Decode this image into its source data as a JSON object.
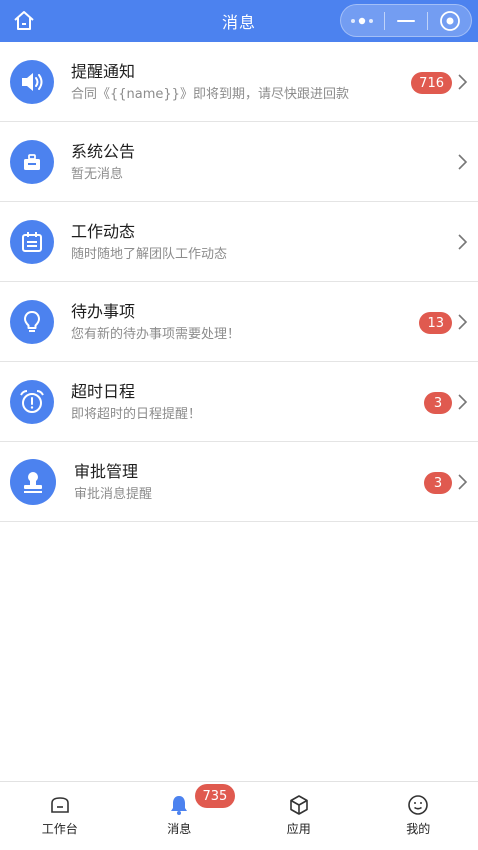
{
  "header": {
    "title": "消息",
    "home_icon": "home-icon",
    "capsule_icons": [
      "more-dots-icon",
      "minimize-icon",
      "close-circle-icon"
    ]
  },
  "colors": {
    "primary": "#4c82ef",
    "badge": "#e05a4f",
    "subtext": "#8c8c8c"
  },
  "messages": [
    {
      "title": "提醒通知",
      "subtitle": "合同《{{name}}》即将到期，请尽快跟进回款",
      "badge": "716",
      "icon": "speaker-icon"
    },
    {
      "title": "系统公告",
      "subtitle": "暂无消息",
      "badge": "",
      "icon": "briefcase-icon"
    },
    {
      "title": "工作动态",
      "subtitle": "随时随地了解团队工作动态",
      "badge": "",
      "icon": "calendar-icon"
    },
    {
      "title": "待办事项",
      "subtitle": "您有新的待办事项需要处理！",
      "badge": "13",
      "icon": "lightbulb-icon"
    },
    {
      "title": "超时日程",
      "subtitle": "即将超时的日程提醒！",
      "badge": "3",
      "icon": "alarm-clock-icon"
    },
    {
      "title": "审批管理",
      "subtitle": "审批消息提醒",
      "badge": "3",
      "icon": "stamp-icon"
    }
  ],
  "tabbar": {
    "items": [
      {
        "label": "工作台",
        "icon": "workbench-icon"
      },
      {
        "label": "消息",
        "icon": "bell-icon",
        "badge": "735"
      },
      {
        "label": "应用",
        "icon": "cube-icon"
      },
      {
        "label": "我的",
        "icon": "smile-face-icon"
      }
    ]
  }
}
